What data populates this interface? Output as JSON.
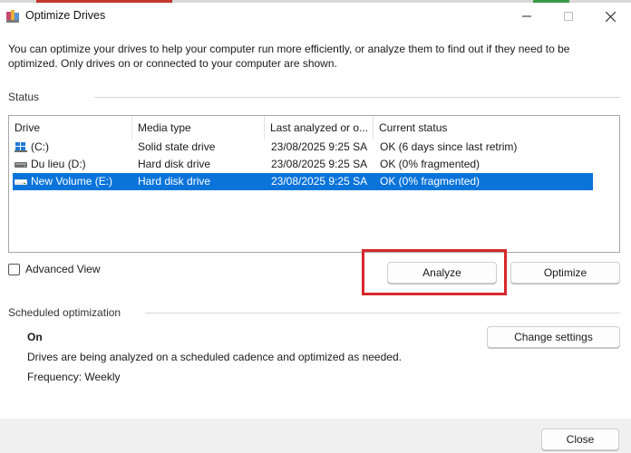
{
  "window": {
    "title": "Optimize Drives",
    "controls": {
      "minimize_icon": "minimize-icon",
      "maximize_icon": "maximize-icon",
      "close_icon": "close-icon"
    }
  },
  "description": "You can optimize your drives to help your computer run more efficiently, or analyze them to find out if they need to be optimized. Only drives on or connected to your computer are shown.",
  "status": {
    "label": "Status",
    "columns": [
      "Drive",
      "Media type",
      "Last analyzed or o...",
      "Current status"
    ],
    "rows": [
      {
        "drive": "(C:)",
        "icon": "windows-drive-icon",
        "media": "Solid state drive",
        "last": "23/08/2025 9:25 SA",
        "status": "OK (6 days since last retrim)",
        "selected": false
      },
      {
        "drive": "Du lieu (D:)",
        "icon": "hard-drive-icon",
        "media": "Hard disk drive",
        "last": "23/08/2025 9:25 SA",
        "status": "OK (0% fragmented)",
        "selected": false
      },
      {
        "drive": "New Volume (E:)",
        "icon": "hard-drive-icon",
        "media": "Hard disk drive",
        "last": "23/08/2025 9:25 SA",
        "status": "OK (0% fragmented)",
        "selected": true
      }
    ]
  },
  "advanced_view": {
    "label": "Advanced View",
    "checked": false
  },
  "buttons": {
    "analyze": "Analyze",
    "optimize": "Optimize",
    "change_settings": "Change settings",
    "close": "Close"
  },
  "scheduled": {
    "label": "Scheduled optimization",
    "state": "On",
    "info": "Drives are being analyzed on a scheduled cadence and optimized as needed.",
    "frequency": "Frequency: Weekly"
  },
  "colors": {
    "selection": "#0a74da",
    "highlight": "#d8272d"
  }
}
